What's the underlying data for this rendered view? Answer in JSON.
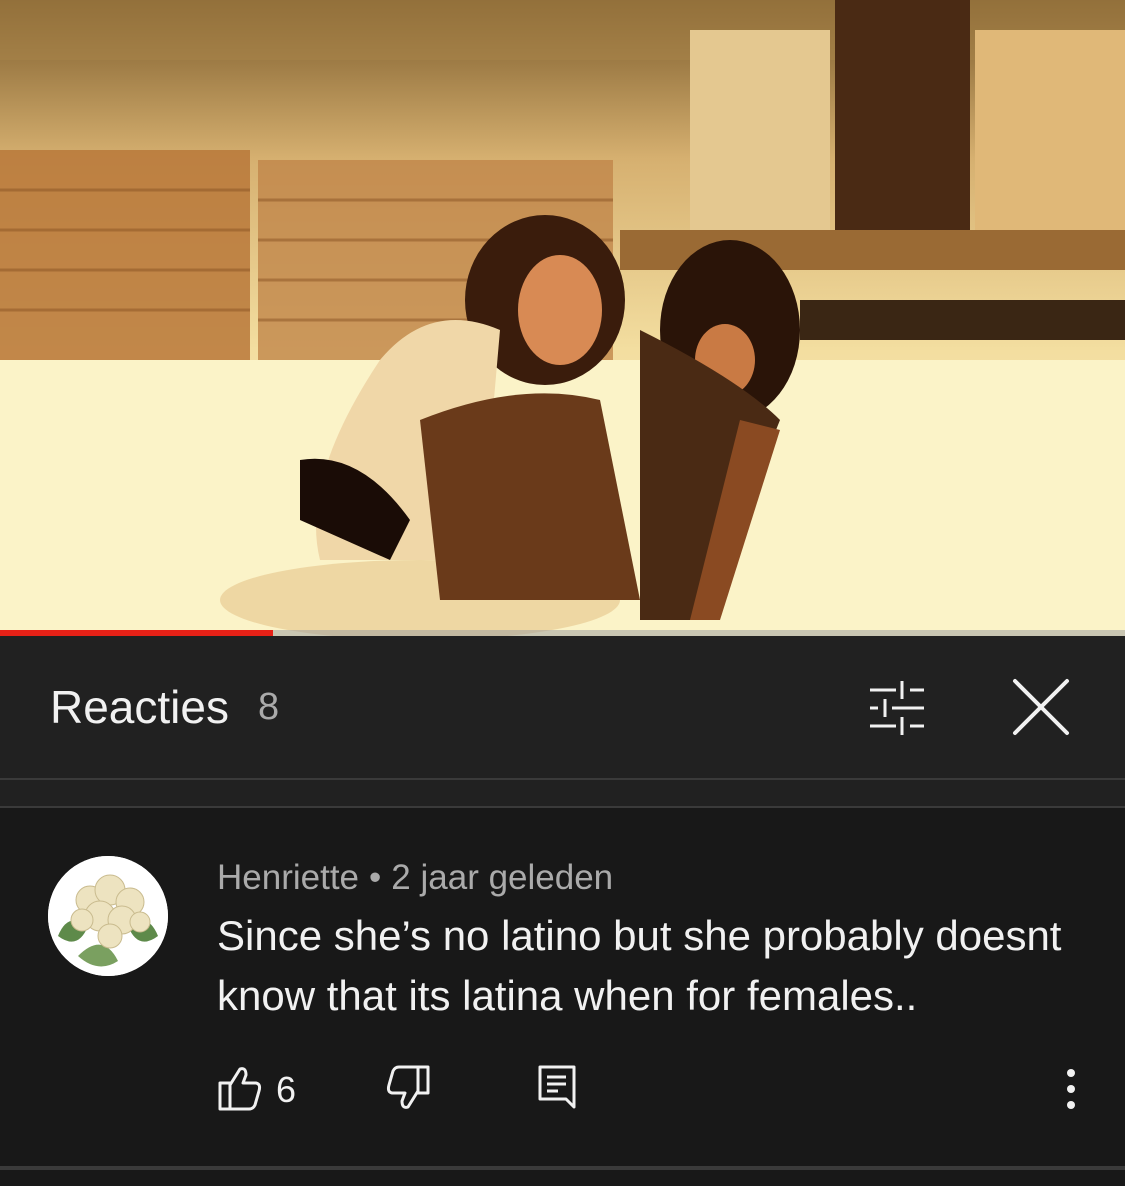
{
  "player": {
    "progress_fraction": 0.243,
    "accent_color": "#e62117"
  },
  "comments_panel": {
    "title": "Reacties",
    "count": "8",
    "filter_icon": "sliders-icon",
    "close_icon": "close-icon"
  },
  "comment": {
    "author": "Henriette",
    "separator": "•",
    "time": "2 jaar geleden",
    "text": "Since she’s no latino but she probably doesnt know that its latina when for  females..",
    "likes": "6",
    "avatar_icon": "cauliflower-avatar",
    "icons": {
      "like": "thumbs-up-icon",
      "dislike": "thumbs-down-icon",
      "reply": "reply-icon",
      "more": "more-vert-icon"
    }
  }
}
